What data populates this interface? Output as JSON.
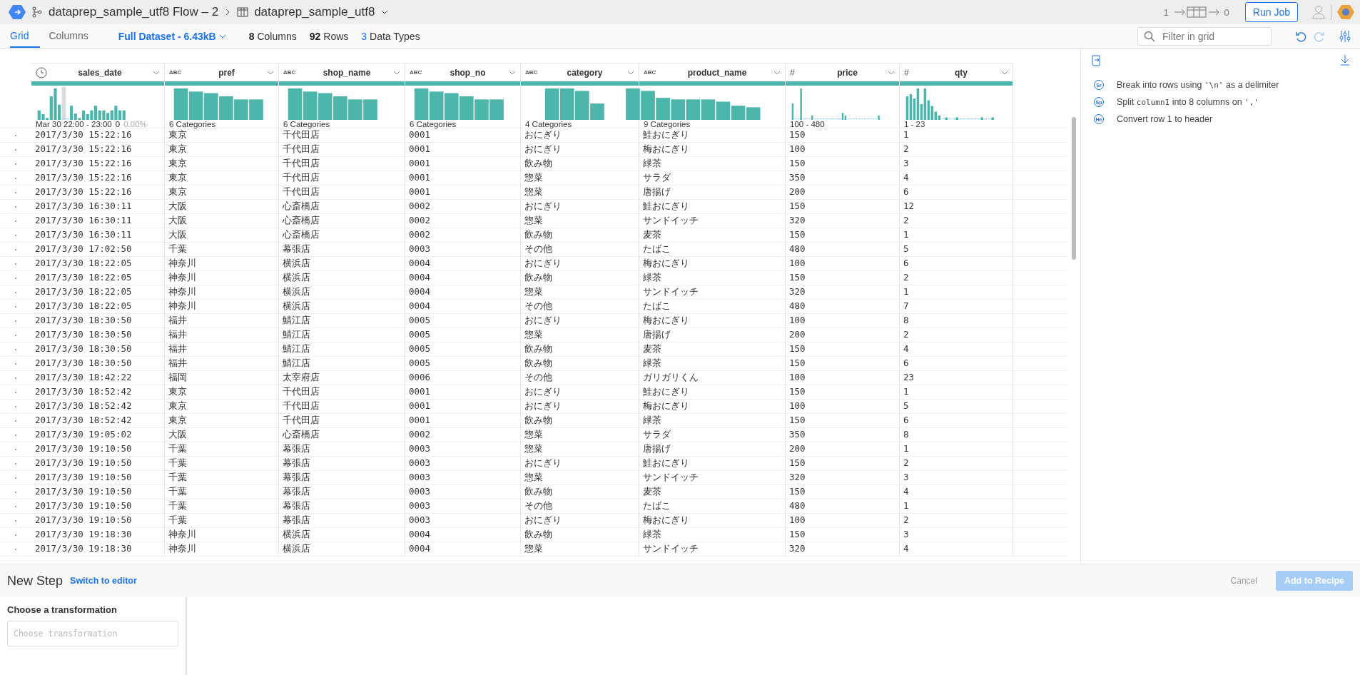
{
  "topbar": {
    "flow_title": "dataprep_sample_utf8 Flow – 2",
    "dataset_title": "dataprep_sample_utf8",
    "inputs": "1",
    "outputs": "0",
    "run_button": "Run Job"
  },
  "tabs": [
    {
      "label": "Grid",
      "selected": true
    },
    {
      "label": "Columns",
      "selected": false
    }
  ],
  "dataset_menu": "Full Dataset - 6.43kB",
  "stats": [
    {
      "text": "**8** Columns",
      "highlight": false
    },
    {
      "text": "**92** Rows",
      "highlight": false
    },
    {
      "text": "**3** Data Types",
      "highlight": true
    }
  ],
  "filter": {
    "placeholder": "Filter in grid"
  },
  "table": {
    "columns": [
      {
        "name": "sales_date",
        "kind": "date",
        "summary": "Mar 30 22:00 - 23:00",
        "count": "0",
        "percent": "0.00%"
      },
      {
        "name": "pref",
        "kind": "string",
        "type_label": "ABC",
        "summary": "6 Categories"
      },
      {
        "name": "shop_name",
        "kind": "string",
        "type_label": "ABC",
        "summary": "6 Categories"
      },
      {
        "name": "shop_no",
        "kind": "string",
        "type_label": "ABC",
        "summary": "6 Categories"
      },
      {
        "name": "category",
        "kind": "string",
        "type_label": "ABC",
        "summary": "4 Categories"
      },
      {
        "name": "product_name",
        "kind": "string",
        "type_label": "ABC",
        "summary": "9 Categories"
      },
      {
        "name": "price",
        "kind": "number",
        "type_label": "#",
        "summary": "100 - 480"
      },
      {
        "name": "qty",
        "kind": "number",
        "type_label": "#",
        "summary": "1 - 23"
      }
    ],
    "rows": [
      [
        "2017/3/30 15:22:16",
        "東京",
        "千代田店",
        "0001",
        "おにぎり",
        "鮭おにぎり",
        "150",
        "1"
      ],
      [
        "2017/3/30 15:22:16",
        "東京",
        "千代田店",
        "0001",
        "おにぎり",
        "梅おにぎり",
        "100",
        "2"
      ],
      [
        "2017/3/30 15:22:16",
        "東京",
        "千代田店",
        "0001",
        "飲み物",
        "緑茶",
        "150",
        "3"
      ],
      [
        "2017/3/30 15:22:16",
        "東京",
        "千代田店",
        "0001",
        "惣菜",
        "サラダ",
        "350",
        "4"
      ],
      [
        "2017/3/30 15:22:16",
        "東京",
        "千代田店",
        "0001",
        "惣菜",
        "唐揚げ",
        "200",
        "6"
      ],
      [
        "2017/3/30 16:30:11",
        "大阪",
        "心斎橋店",
        "0002",
        "おにぎり",
        "鮭おにぎり",
        "150",
        "12"
      ],
      [
        "2017/3/30 16:30:11",
        "大阪",
        "心斎橋店",
        "0002",
        "惣菜",
        "サンドイッチ",
        "320",
        "2"
      ],
      [
        "2017/3/30 16:30:11",
        "大阪",
        "心斎橋店",
        "0002",
        "飲み物",
        "麦茶",
        "150",
        "1"
      ],
      [
        "2017/3/30 17:02:50",
        "千葉",
        "幕張店",
        "0003",
        "その他",
        "たばこ",
        "480",
        "5"
      ],
      [
        "2017/3/30 18:22:05",
        "神奈川",
        "横浜店",
        "0004",
        "おにぎり",
        "梅おにぎり",
        "100",
        "6"
      ],
      [
        "2017/3/30 18:22:05",
        "神奈川",
        "横浜店",
        "0004",
        "飲み物",
        "緑茶",
        "150",
        "2"
      ],
      [
        "2017/3/30 18:22:05",
        "神奈川",
        "横浜店",
        "0004",
        "惣菜",
        "サンドイッチ",
        "320",
        "1"
      ],
      [
        "2017/3/30 18:22:05",
        "神奈川",
        "横浜店",
        "0004",
        "その他",
        "たばこ",
        "480",
        "7"
      ],
      [
        "2017/3/30 18:30:50",
        "福井",
        "鯖江店",
        "0005",
        "おにぎり",
        "梅おにぎり",
        "100",
        "8"
      ],
      [
        "2017/3/30 18:30:50",
        "福井",
        "鯖江店",
        "0005",
        "惣菜",
        "唐揚げ",
        "200",
        "2"
      ],
      [
        "2017/3/30 18:30:50",
        "福井",
        "鯖江店",
        "0005",
        "飲み物",
        "麦茶",
        "150",
        "4"
      ],
      [
        "2017/3/30 18:30:50",
        "福井",
        "鯖江店",
        "0005",
        "飲み物",
        "緑茶",
        "150",
        "6"
      ],
      [
        "2017/3/30 18:42:22",
        "福岡",
        "太宰府店",
        "0006",
        "その他",
        "ガリガリくん",
        "100",
        "23"
      ],
      [
        "2017/3/30 18:52:42",
        "東京",
        "千代田店",
        "0001",
        "おにぎり",
        "鮭おにぎり",
        "150",
        "1"
      ],
      [
        "2017/3/30 18:52:42",
        "東京",
        "千代田店",
        "0001",
        "おにぎり",
        "梅おにぎり",
        "100",
        "5"
      ],
      [
        "2017/3/30 18:52:42",
        "東京",
        "千代田店",
        "0001",
        "飲み物",
        "緑茶",
        "150",
        "6"
      ],
      [
        "2017/3/30 19:05:02",
        "大阪",
        "心斎橋店",
        "0002",
        "惣菜",
        "サラダ",
        "350",
        "8"
      ],
      [
        "2017/3/30 19:10:50",
        "千葉",
        "幕張店",
        "0003",
        "惣菜",
        "唐揚げ",
        "200",
        "1"
      ],
      [
        "2017/3/30 19:10:50",
        "千葉",
        "幕張店",
        "0003",
        "おにぎり",
        "鮭おにぎり",
        "150",
        "2"
      ],
      [
        "2017/3/30 19:10:50",
        "千葉",
        "幕張店",
        "0003",
        "惣菜",
        "サンドイッチ",
        "320",
        "3"
      ],
      [
        "2017/3/30 19:10:50",
        "千葉",
        "幕張店",
        "0003",
        "飲み物",
        "麦茶",
        "150",
        "4"
      ],
      [
        "2017/3/30 19:10:50",
        "千葉",
        "幕張店",
        "0003",
        "その他",
        "たばこ",
        "480",
        "1"
      ],
      [
        "2017/3/30 19:10:50",
        "千葉",
        "幕張店",
        "0003",
        "おにぎり",
        "梅おにぎり",
        "100",
        "2"
      ],
      [
        "2017/3/30 19:18:30",
        "神奈川",
        "横浜店",
        "0004",
        "飲み物",
        "緑茶",
        "150",
        "3"
      ],
      [
        "2017/3/30 19:18:30",
        "神奈川",
        "横浜店",
        "0004",
        "惣菜",
        "サンドイッチ",
        "320",
        "4"
      ]
    ]
  },
  "recipe": [
    {
      "badge": "Sr",
      "parts": [
        {
          "text": "Break into rows using ",
          "code": false
        },
        {
          "text": "'\\n'",
          "code": true
        },
        {
          "text": " as a delimiter",
          "code": false
        }
      ]
    },
    {
      "badge": "Sp",
      "parts": [
        {
          "text": "Split ",
          "code": false
        },
        {
          "text": "column1",
          "code": true
        },
        {
          "text": " into 8 columns on ",
          "code": false
        },
        {
          "text": "','",
          "code": true
        }
      ]
    },
    {
      "badge": "He",
      "parts": [
        {
          "text": "Convert row 1 to header",
          "code": false
        }
      ]
    }
  ],
  "new_step": {
    "title": "New Step",
    "switch_link": "Switch to editor",
    "cancel": "Cancel",
    "add": "Add to Recipe",
    "add_disabled": true,
    "cancel_disabled": true,
    "field_label": "Choose a transformation",
    "placeholder": "Choose transformation"
  }
}
